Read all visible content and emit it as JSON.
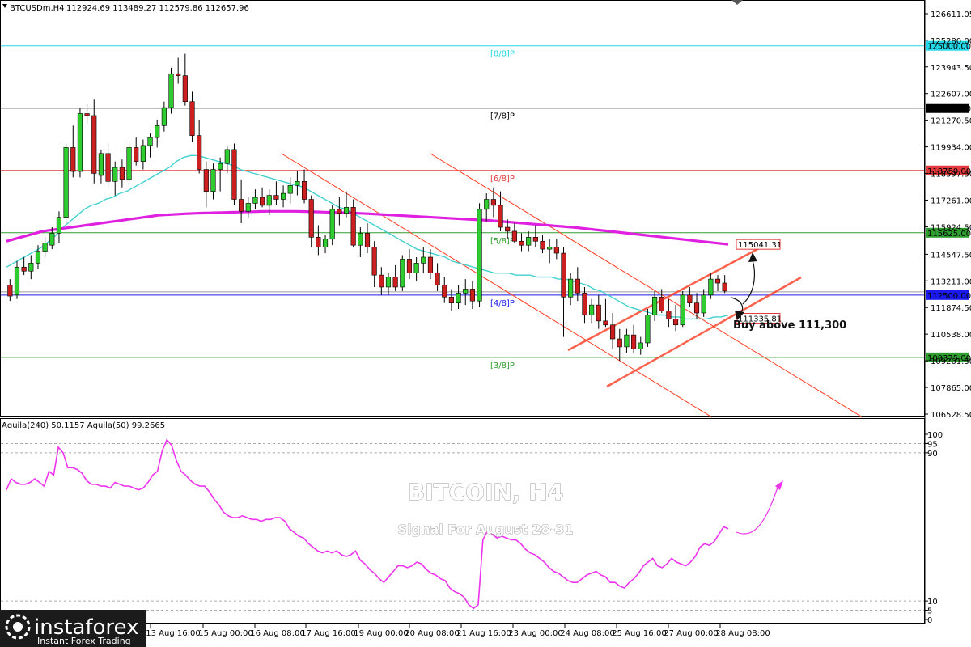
{
  "header": {
    "symbol": "BTCUSDm,H4",
    "ohlc": "112924.69 113489.27 112579.86 112657.96"
  },
  "indicator_header": "Aguila(240) 50.1157  Aguila(50) 99.2665",
  "chart_title": "BITCOIN, H4",
  "chart_subtitle": "Signal For August 28-31",
  "annotation": "Buy above 111,300",
  "logo": {
    "name": "instaforex",
    "tagline": "Instant Forex Trading"
  },
  "colors": {
    "bull": "#2ecc2e",
    "bear": "#cc1f1f",
    "ma_fast": "#40d0d0",
    "ma_slow": "#e020e0",
    "oscillator": "#ee33ee",
    "channel": "#ff3b1f",
    "level_cyan": "#22d8e8",
    "level_red": "#e33b3b",
    "level_green": "#2e9e2e",
    "level_black": "#000000",
    "level_blue": "#1a1aee"
  },
  "price_axis_ticks": [
    "126611.05",
    "125280.00",
    "123943.50",
    "122607.00",
    "121270.50",
    "119934.00",
    "118597.50",
    "117261.00",
    "115924.50",
    "114547.50",
    "113211.00",
    "111874.50",
    "110538.00",
    "109201.50",
    "107865.00",
    "106528.50"
  ],
  "osc_axis_ticks": [
    "100",
    "95",
    "90",
    "10",
    "5",
    "0"
  ],
  "time_axis_ticks": [
    "13 Aug 16:00",
    "15 Aug 00:00",
    "16 Aug 08:00",
    "17 Aug 16:00",
    "19 Aug 00:00",
    "20 Aug 08:00",
    "21 Aug 16:00",
    "23 Aug 00:00",
    "24 Aug 08:00",
    "25 Aug 16:00",
    "27 Aug 00:00",
    "28 Aug 08:00"
  ],
  "levels": [
    {
      "label": "[8/8]P",
      "price": 125000,
      "tag": "125000.00",
      "color": "cyan"
    },
    {
      "label": "[7/8]P",
      "price": 121875,
      "tag": "121875.00",
      "color": "black"
    },
    {
      "label": "[6/8]P",
      "price": 118750,
      "tag": "118750.00",
      "color": "red"
    },
    {
      "label": "[5/8]P",
      "price": 115625,
      "tag": "115625.00",
      "color": "green"
    },
    {
      "label": "[4/8]P",
      "price": 112500,
      "tag": "112500.00",
      "color": "blue"
    },
    {
      "label": "[3/8]P",
      "price": 109375,
      "tag": "109375.00",
      "color": "green"
    }
  ],
  "price_tags": [
    {
      "text": "115041.31",
      "price": 115041.31
    },
    {
      "text": "111335.81",
      "price": 111335.81
    }
  ],
  "chart_data": {
    "type": "candlestick",
    "symbol": "BTCUSDm",
    "timeframe": "H4",
    "ylim": [
      106528.5,
      126611.05
    ],
    "osc_ylim": [
      0,
      100
    ],
    "candles": [
      [
        113000,
        113300,
        112200,
        112450
      ],
      [
        112500,
        114200,
        112300,
        113900
      ],
      [
        113900,
        114400,
        113500,
        113700
      ],
      [
        113700,
        114500,
        113300,
        114100
      ],
      [
        114100,
        115000,
        113800,
        114700
      ],
      [
        114700,
        115400,
        114400,
        115100
      ],
      [
        115000,
        115900,
        114800,
        115600
      ],
      [
        115600,
        116700,
        115100,
        116400
      ],
      [
        116400,
        120100,
        116100,
        119900
      ],
      [
        119900,
        121000,
        118400,
        118700
      ],
      [
        118700,
        121900,
        118400,
        121600
      ],
      [
        121600,
        122100,
        121100,
        121500
      ],
      [
        121500,
        122300,
        118100,
        118600
      ],
      [
        118500,
        119800,
        118100,
        119600
      ],
      [
        119600,
        120100,
        117900,
        118200
      ],
      [
        118200,
        119200,
        117500,
        118900
      ],
      [
        118900,
        119300,
        117900,
        118300
      ],
      [
        118300,
        120200,
        118100,
        119900
      ],
      [
        119900,
        120400,
        119000,
        119200
      ],
      [
        119200,
        120300,
        118800,
        120000
      ],
      [
        120000,
        120600,
        119400,
        120400
      ],
      [
        120400,
        121300,
        119900,
        121000
      ],
      [
        121000,
        122200,
        120700,
        121900
      ],
      [
        121900,
        123900,
        121600,
        123600
      ],
      [
        123600,
        124400,
        123100,
        123500
      ],
      [
        123500,
        124600,
        122000,
        122200
      ],
      [
        122200,
        122700,
        120200,
        120500
      ],
      [
        120500,
        121300,
        118600,
        118800
      ],
      [
        118800,
        119200,
        116900,
        117700
      ],
      [
        117700,
        119100,
        117300,
        118800
      ],
      [
        118800,
        119400,
        117700,
        119100
      ],
      [
        119100,
        120000,
        118600,
        119800
      ],
      [
        119800,
        120100,
        117000,
        117300
      ],
      [
        117300,
        118300,
        116100,
        116700
      ],
      [
        116700,
        117400,
        116400,
        117100
      ],
      [
        117100,
        117800,
        116800,
        117400
      ],
      [
        117400,
        117900,
        116900,
        117000
      ],
      [
        117000,
        117800,
        116500,
        117500
      ],
      [
        117500,
        118200,
        117000,
        117300
      ],
      [
        117300,
        118000,
        116900,
        117600
      ],
      [
        117600,
        118400,
        117100,
        118000
      ],
      [
        118000,
        118700,
        117500,
        118200
      ],
      [
        118200,
        118800,
        117100,
        117300
      ],
      [
        117300,
        117500,
        114900,
        115400
      ],
      [
        115400,
        116000,
        114500,
        114900
      ],
      [
        114900,
        115500,
        114600,
        115300
      ],
      [
        115300,
        117000,
        115000,
        116800
      ],
      [
        116800,
        117400,
        116000,
        116600
      ],
      [
        116600,
        117700,
        116400,
        116900
      ],
      [
        116900,
        117300,
        114900,
        115000
      ],
      [
        115000,
        115900,
        114400,
        115600
      ],
      [
        115600,
        116100,
        114600,
        114900
      ],
      [
        114900,
        115200,
        112900,
        113500
      ],
      [
        113500,
        113900,
        112500,
        112900
      ],
      [
        112900,
        113600,
        112500,
        113400
      ],
      [
        113400,
        114000,
        112700,
        112900
      ],
      [
        112900,
        114500,
        112700,
        114300
      ],
      [
        114300,
        114800,
        113300,
        113600
      ],
      [
        113600,
        114400,
        113200,
        114100
      ],
      [
        114100,
        114900,
        113600,
        114400
      ],
      [
        114400,
        114800,
        113300,
        113600
      ],
      [
        113600,
        114100,
        112700,
        113000
      ],
      [
        113000,
        113400,
        112100,
        112400
      ],
      [
        112400,
        112800,
        111700,
        112100
      ],
      [
        112100,
        113000,
        111800,
        112600
      ],
      [
        112600,
        113300,
        112000,
        112800
      ],
      [
        112800,
        113200,
        111800,
        112200
      ],
      [
        112200,
        117100,
        111900,
        116800
      ],
      [
        116800,
        117600,
        116200,
        117300
      ],
      [
        117300,
        117900,
        116400,
        117000
      ],
      [
        117000,
        117700,
        115700,
        115900
      ],
      [
        115900,
        116300,
        115300,
        115700
      ],
      [
        115700,
        116100,
        115100,
        115200
      ],
      [
        115200,
        115600,
        114700,
        115000
      ],
      [
        115000,
        115700,
        114700,
        115400
      ],
      [
        115400,
        116000,
        114900,
        115200
      ],
      [
        115200,
        115500,
        114600,
        114800
      ],
      [
        114800,
        115300,
        114100,
        114900
      ],
      [
        114900,
        115300,
        114300,
        114600
      ],
      [
        114600,
        114900,
        110400,
        112400
      ],
      [
        112400,
        113600,
        112000,
        113300
      ],
      [
        113300,
        113900,
        112200,
        112600
      ],
      [
        112600,
        112900,
        111100,
        111500
      ],
      [
        111500,
        112300,
        111100,
        112000
      ],
      [
        112000,
        112500,
        110800,
        111200
      ],
      [
        111200,
        112300,
        110900,
        111000
      ],
      [
        111000,
        111600,
        109800,
        110300
      ],
      [
        110300,
        110800,
        109200,
        109900
      ],
      [
        109900,
        110800,
        109600,
        110500
      ],
      [
        110500,
        111000,
        109600,
        109800
      ],
      [
        109800,
        110400,
        109500,
        110100
      ],
      [
        110100,
        111800,
        109900,
        111500
      ],
      [
        111500,
        112700,
        111200,
        112400
      ],
      [
        112400,
        112800,
        111600,
        111700
      ],
      [
        111700,
        112300,
        110900,
        111300
      ],
      [
        111300,
        112000,
        110700,
        111000
      ],
      [
        111000,
        112700,
        110900,
        112500
      ],
      [
        112500,
        112900,
        111900,
        112100
      ],
      [
        112100,
        112600,
        111300,
        111600
      ],
      [
        111600,
        112800,
        111400,
        112500
      ],
      [
        112500,
        113600,
        112300,
        113300
      ],
      [
        113300,
        113500,
        112700,
        113100
      ],
      [
        113100,
        113500,
        112600,
        112700
      ]
    ],
    "ma_fast": [
      113900,
      114100,
      114300,
      114500,
      114700,
      114900,
      115200,
      115500,
      115900,
      116200,
      116500,
      116800,
      117000,
      117100,
      117300,
      117400,
      117600,
      117700,
      117900,
      118100,
      118300,
      118500,
      118700,
      118900,
      119200,
      119400,
      119500,
      119500,
      119400,
      119300,
      119200,
      119100,
      119000,
      118800,
      118700,
      118600,
      118500,
      118400,
      118300,
      118200,
      118100,
      118000,
      117900,
      117700,
      117500,
      117300,
      117100,
      116900,
      116800,
      116600,
      116400,
      116200,
      116000,
      115800,
      115600,
      115400,
      115200,
      115000,
      114800,
      114700,
      114600,
      114500,
      114400,
      114200,
      114100,
      114000,
      113900,
      113800,
      113700,
      113600,
      113600,
      113600,
      113500,
      113500,
      113500,
      113400,
      113400,
      113400,
      113300,
      113300,
      113200,
      113100,
      113000,
      112800,
      112700,
      112500,
      112300,
      112100,
      111900,
      111800,
      111700,
      111600,
      111500,
      111500,
      111400,
      111400,
      111300,
      111300,
      111300,
      111300,
      111400,
      111400,
      111500
    ],
    "ma_slow": [
      115200,
      115300,
      115400,
      115500,
      115600,
      115700,
      115750,
      115800,
      115850,
      115900,
      115950,
      116000,
      116050,
      116100,
      116150,
      116200,
      116250,
      116300,
      116350,
      116400,
      116450,
      116500,
      116520,
      116540,
      116560,
      116580,
      116600,
      116610,
      116620,
      116630,
      116640,
      116650,
      116660,
      116670,
      116680,
      116690,
      116700,
      116700,
      116700,
      116700,
      116700,
      116690,
      116680,
      116670,
      116660,
      116650,
      116640,
      116630,
      116620,
      116600,
      116580,
      116560,
      116540,
      116520,
      116500,
      116480,
      116460,
      116440,
      116420,
      116400,
      116380,
      116360,
      116340,
      116320,
      116300,
      116280,
      116260,
      116240,
      116210,
      116180,
      116150,
      116120,
      116090,
      116060,
      116030,
      116000,
      115970,
      115940,
      115910,
      115880,
      115840,
      115800,
      115760,
      115720,
      115680,
      115640,
      115600,
      115560,
      115520,
      115480,
      115440,
      115400,
      115360,
      115320,
      115280,
      115240,
      115200,
      115160,
      115120,
      115080,
      115041.31
    ],
    "oscillator": [
      70,
      76,
      74,
      73,
      73,
      74,
      76,
      74,
      72,
      80,
      78,
      93,
      90,
      82,
      82,
      81,
      79,
      75,
      73,
      73,
      72,
      72,
      71,
      74,
      73,
      72,
      72,
      71,
      70,
      71,
      74,
      78,
      80,
      91,
      97,
      94,
      86,
      80,
      78,
      75,
      73,
      72,
      72,
      69,
      65,
      62,
      58,
      56,
      55,
      55,
      56,
      55,
      54,
      54,
      53,
      54,
      54,
      55,
      55,
      53,
      49,
      47,
      45,
      44,
      41,
      39,
      37,
      36,
      37,
      36,
      37,
      35,
      34,
      35,
      37,
      32,
      30,
      27,
      25,
      22,
      20,
      23,
      26,
      29,
      29,
      28,
      29,
      31,
      30,
      27,
      25,
      24,
      22,
      21,
      17,
      15,
      14,
      12,
      8,
      6,
      8,
      43,
      48,
      46,
      44,
      45,
      44,
      43,
      43,
      41,
      38,
      36,
      35,
      33,
      31,
      28,
      26,
      25,
      23,
      21,
      20,
      20,
      22,
      24,
      25,
      26,
      24,
      23,
      20,
      20,
      18,
      17,
      20,
      22,
      25,
      29,
      31,
      33,
      29,
      28,
      30,
      33,
      31,
      30,
      29,
      31,
      34,
      39,
      41,
      40,
      42,
      46,
      50,
      49
    ],
    "channel_lines": [
      {
        "name": "descending-upper",
        "p1": [
          0.0,
          119950
        ],
        "p2": [
          1.0,
          106528
        ]
      },
      {
        "name": "descending-lower",
        "p1": [
          0.0,
          119800
        ],
        "p2": [
          1.0,
          106528
        ]
      },
      {
        "name": "ascending-upper",
        "p1": [
          0.0,
          110700
        ],
        "p2": [
          1.0,
          114800
        ]
      },
      {
        "name": "ascending-lower",
        "p1": [
          0.0,
          107700
        ],
        "p2": [
          1.0,
          112700
        ]
      }
    ]
  }
}
